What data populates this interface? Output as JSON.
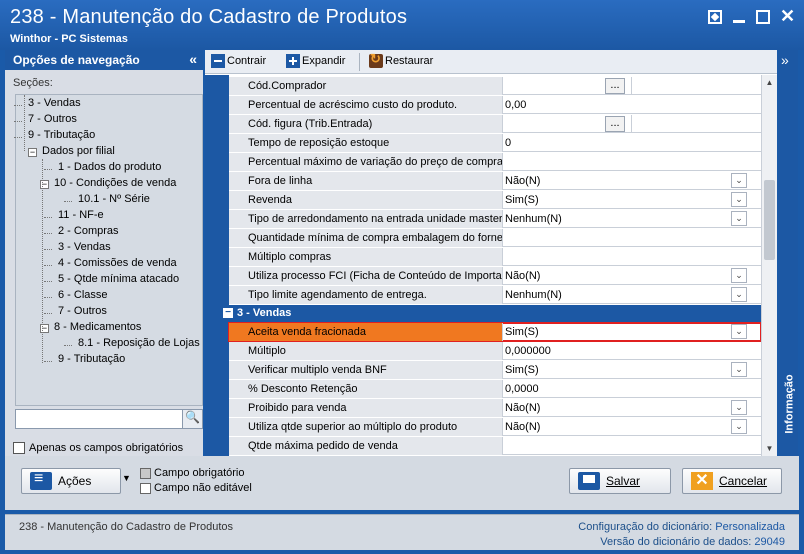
{
  "window": {
    "title": "238 - Manutenção do Cadastro de Produtos",
    "subtitle": "Winthor - PC Sistemas"
  },
  "nav": {
    "header": "Opções de navegação",
    "sections_label": "Seções:",
    "tree": [
      {
        "label": "3 - Vendas",
        "level": 1
      },
      {
        "label": "7 - Outros",
        "level": 1
      },
      {
        "label": "9 - Tributação",
        "level": 1
      },
      {
        "label": "Dados por filial",
        "level": 0,
        "expanded": true
      },
      {
        "label": "1 - Dados do produto",
        "level": 2
      },
      {
        "label": "10 - Condições de venda",
        "level": 2,
        "expanded": true
      },
      {
        "label": "10.1 - Nº Série",
        "level": 3
      },
      {
        "label": "11 - NF-e",
        "level": 2
      },
      {
        "label": "2 - Compras",
        "level": 2
      },
      {
        "label": "3 - Vendas",
        "level": 2
      },
      {
        "label": "4 - Comissões de venda",
        "level": 2
      },
      {
        "label": "5 - Qtde mínima atacado",
        "level": 2
      },
      {
        "label": "6 - Classe",
        "level": 2
      },
      {
        "label": "7 - Outros",
        "level": 2
      },
      {
        "label": "8 - Medicamentos",
        "level": 2,
        "expanded": true
      },
      {
        "label": "8.1 -  Reposição de Lojas",
        "level": 3
      },
      {
        "label": "9 - Tributação",
        "level": 2
      }
    ],
    "search_value": "",
    "only_required_label": "Apenas os campos obrigatórios"
  },
  "toolbar": {
    "collapse_label": "Contrair",
    "expand_label": "Expandir",
    "restore_label": "Restaurar"
  },
  "grid": {
    "rows_top": [
      {
        "label": "Cód.Comprador",
        "value": "",
        "control": "ellipsis"
      },
      {
        "label": "Percentual de acréscimo custo do produto.",
        "value": "0,00",
        "control": "text"
      },
      {
        "label": "Cód. figura (Trib.Entrada)",
        "value": "",
        "control": "ellipsis"
      },
      {
        "label": "Tempo de reposição estoque",
        "value": "0",
        "control": "text"
      },
      {
        "label": "Percentual máximo de variação do preço de compra",
        "value": "",
        "control": "text"
      },
      {
        "label": "Fora de linha",
        "value": "Não(N)",
        "control": "dropdown"
      },
      {
        "label": "Revenda",
        "value": "Sim(S)",
        "control": "dropdown"
      },
      {
        "label": "Tipo de arredondamento na entrada unidade master",
        "value": "Nenhum(N)",
        "control": "dropdown"
      },
      {
        "label": "Quantidade mínima de compra embalagem do fornec",
        "value": "",
        "control": "text"
      },
      {
        "label": "Múltiplo compras",
        "value": "",
        "control": "text"
      },
      {
        "label": "Utiliza processo FCI (Ficha de Conteúdo de Importaç",
        "value": "Não(N)",
        "control": "dropdown"
      },
      {
        "label": "Tipo limite agendamento de entrega.",
        "value": "Nenhum(N)",
        "control": "dropdown"
      }
    ],
    "section": {
      "label": "3 - Vendas",
      "expander": "−"
    },
    "rows_bottom": [
      {
        "label": "Aceita venda fracionada",
        "value": "Sim(S)",
        "control": "dropdown",
        "highlight": true
      },
      {
        "label": "Múltiplo",
        "value": "0,000000",
        "control": "text"
      },
      {
        "label": "Verificar multiplo venda BNF",
        "value": "Sim(S)",
        "control": "dropdown"
      },
      {
        "label": "% Desconto Retenção",
        "value": "0,0000",
        "control": "text"
      },
      {
        "label": "Proibido para venda",
        "value": "Não(N)",
        "control": "dropdown"
      },
      {
        "label": "Utiliza qtde superior ao múltiplo do produto",
        "value": "Não(N)",
        "control": "dropdown"
      },
      {
        "label": "Qtde máxima pedido de venda",
        "value": "",
        "control": "text"
      }
    ]
  },
  "info_panel": {
    "label": "Informação"
  },
  "bottom": {
    "actions_label": "Ações",
    "legend_required": "Campo obrigatório",
    "legend_readonly": "Campo não editável",
    "save_label": "Salvar",
    "cancel_label": "Cancelar"
  },
  "status": {
    "left": "238 - Manutenção do Cadastro de Produtos",
    "dict_config_label": "Configuração do dicionário:",
    "dict_config_value": "Personalizada",
    "dict_version_label": "Versão do dicionário de dados:",
    "dict_version_value": "29049"
  },
  "colors": {
    "brand_blue": "#1c58a4",
    "highlight_orange": "#f07820",
    "highlight_border": "#e02020"
  }
}
